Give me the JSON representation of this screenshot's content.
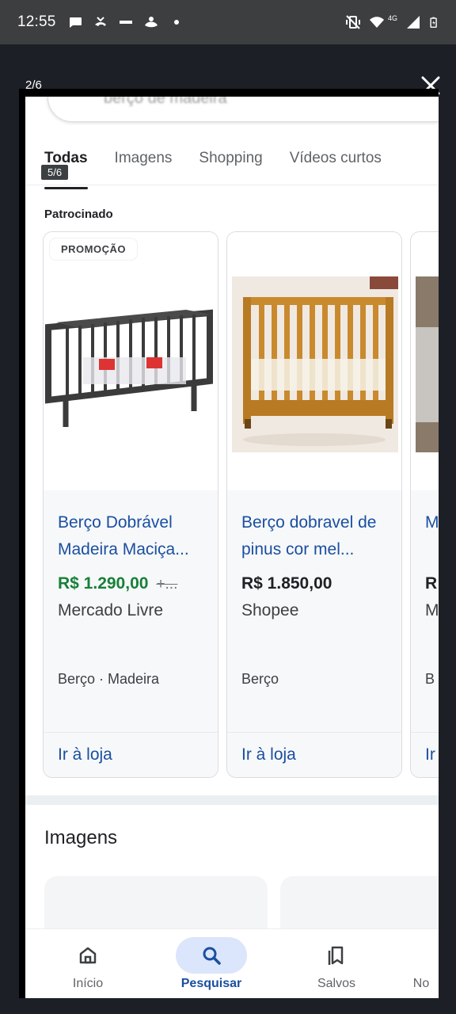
{
  "status_bar": {
    "time": "12:55",
    "network": "4G"
  },
  "viewer": {
    "counter": "2/6",
    "close_icon": "close-icon"
  },
  "search": {
    "query": "berço de madeira"
  },
  "tabs": [
    {
      "label": "Todas",
      "active": true
    },
    {
      "label": "Imagens",
      "active": false
    },
    {
      "label": "Shopping",
      "active": false
    },
    {
      "label": "Vídeos curtos",
      "active": false
    }
  ],
  "tab_badge": "5/6",
  "sponsored_label": "Patrocinado",
  "cards": [
    {
      "badge": "PROMOÇÃO",
      "title": "Berço Dobrável Madeira Maciça...",
      "price": "R$ 1.290,00",
      "old_price": "+...",
      "store": "Mercado Livre",
      "category": "Berço · Madeira",
      "cta": "Ir à loja"
    },
    {
      "title": "Berço dobravel de pinus cor mel...",
      "price": "R$ 1.850,00",
      "store": "Shopee",
      "category": "Berço",
      "cta": "Ir à loja"
    },
    {
      "title": "M M",
      "price": "R",
      "store": "M",
      "category": "B",
      "cta": "Ir"
    }
  ],
  "images_heading": "Imagens",
  "bottom_nav": [
    {
      "label": "Início",
      "icon": "home-icon",
      "active": false
    },
    {
      "label": "Pesquisar",
      "icon": "search-icon",
      "active": true
    },
    {
      "label": "Salvos",
      "icon": "bookmark-icon",
      "active": false
    },
    {
      "label": "No",
      "icon": "notifications-icon",
      "active": false
    }
  ],
  "colors": {
    "link_blue": "#1a4fa0",
    "price_green": "#188038",
    "active_nav_bg": "#dbe5fb"
  }
}
